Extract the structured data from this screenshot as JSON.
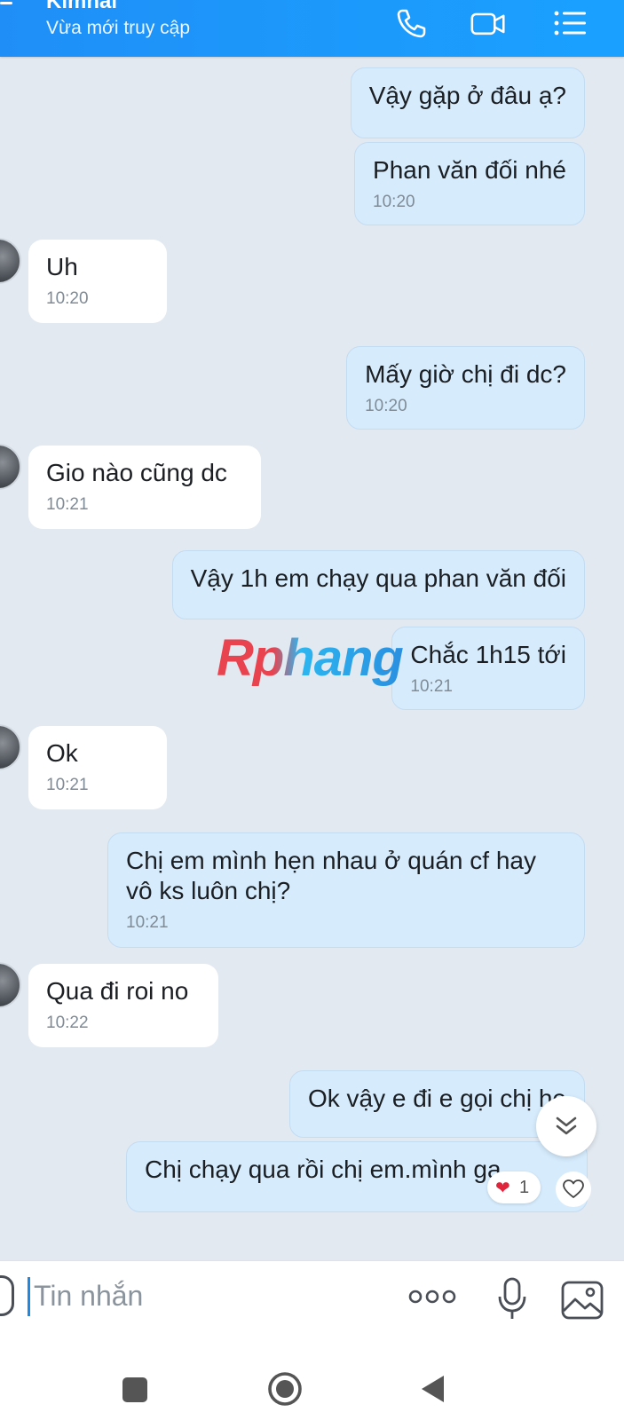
{
  "header": {
    "contact_name": "Kimhai",
    "status": "Vừa mới truy cập"
  },
  "watermark": "Rphang",
  "messages": [
    {
      "dir": "out",
      "text": "Vậy gặp ở đâu ạ?",
      "time": ""
    },
    {
      "dir": "out",
      "text": "Phan văn đối nhé",
      "time": "10:20"
    },
    {
      "dir": "in",
      "text": "Uh",
      "time": "10:20"
    },
    {
      "dir": "out",
      "text": "Mấy giờ chị đi dc?",
      "time": "10:20"
    },
    {
      "dir": "in",
      "text": "Gio nào cũng dc",
      "time": "10:21"
    },
    {
      "dir": "out",
      "text": "Vậy 1h em chạy qua phan văn đối",
      "time": ""
    },
    {
      "dir": "out",
      "text": "Chắc 1h15 tới",
      "time": "10:21"
    },
    {
      "dir": "in",
      "text": "Ok",
      "time": "10:21"
    },
    {
      "dir": "out",
      "text": "Chị em mình hẹn nhau ở quán cf hay vô ks luôn chị?",
      "time": "10:21"
    },
    {
      "dir": "in",
      "text": "Qua đi roi no",
      "time": "10:22"
    },
    {
      "dir": "out",
      "text": "Ok vậy e đi e gọi chị he",
      "time": ""
    },
    {
      "dir": "out",
      "text": "Chị chạy qua rồi chị em.mình ga",
      "time": ""
    }
  ],
  "reaction": {
    "emoji": "❤",
    "count": "1"
  },
  "composer": {
    "placeholder": "Tin nhắn"
  },
  "colors": {
    "accent": "#1f8ff7",
    "outgoing_bubble": "#d6ecfd",
    "incoming_bubble": "#ffffff"
  },
  "icons": [
    "back-icon",
    "phone-icon",
    "video-call-icon",
    "menu-list-icon",
    "chevron-double-down-icon",
    "heart-icon",
    "emoji-icon",
    "more-dots-icon",
    "microphone-icon",
    "image-icon",
    "nav-recent-icon",
    "nav-home-icon",
    "nav-back-icon"
  ]
}
